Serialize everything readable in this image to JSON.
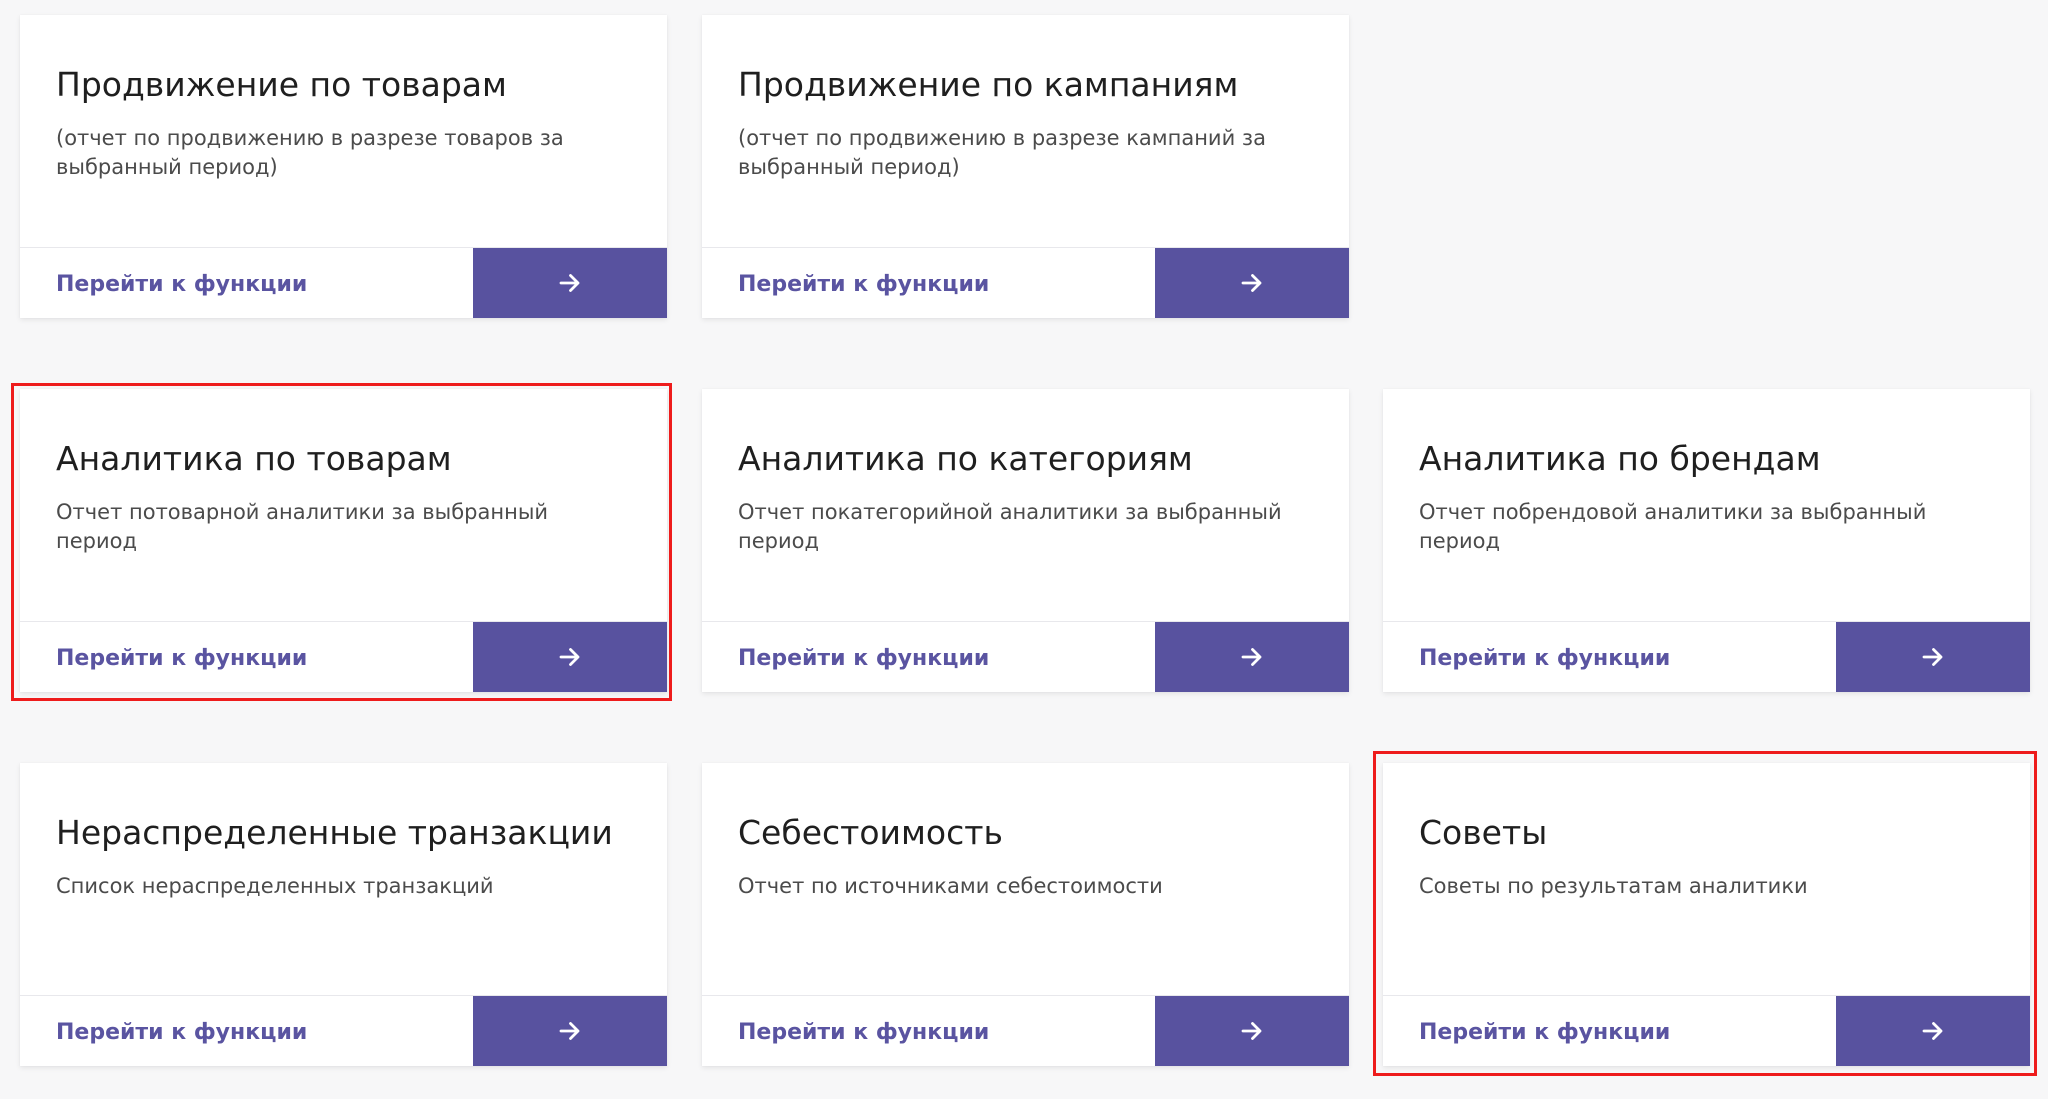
{
  "colors": {
    "page_background": "#f7f7f8",
    "card_background": "#ffffff",
    "accent": "#58529f",
    "link_text": "#5a54a1",
    "highlight_border": "#ee1c1c"
  },
  "icons": {
    "button_icon": "arrow-right-icon"
  },
  "cards": [
    {
      "title": "Продвижение по товарам",
      "description": "(отчет по продвижению в разрезе товаров за выбранный период)",
      "link_label": "Перейти к функции",
      "highlighted": false
    },
    {
      "title": "Продвижение по кампаниям",
      "description": "(отчет по продвижению в разрезе кампаний за выбранный период)",
      "link_label": "Перейти к функции",
      "highlighted": false
    },
    {
      "title": "Аналитика по товарам",
      "description": "Отчет потоварной аналитики за выбранный период",
      "link_label": "Перейти к функции",
      "highlighted": true
    },
    {
      "title": "Аналитика по категориям",
      "description": "Отчет покатегорийной аналитики за выбранный период",
      "link_label": "Перейти к функции",
      "highlighted": false
    },
    {
      "title": "Аналитика по брендам",
      "description": "Отчет побрендовой аналитики за выбранный период",
      "link_label": "Перейти к функции",
      "highlighted": false
    },
    {
      "title": "Нераспределенные транзакции",
      "description": "Список нераспределенных транзакций",
      "link_label": "Перейти к функции",
      "highlighted": false
    },
    {
      "title": "Себестоимость",
      "description": "Отчет по источниками себестоимости",
      "link_label": "Перейти к функции",
      "highlighted": false
    },
    {
      "title": "Советы",
      "description": "Советы по результатам аналитики",
      "link_label": "Перейти к функции",
      "highlighted": true
    }
  ]
}
